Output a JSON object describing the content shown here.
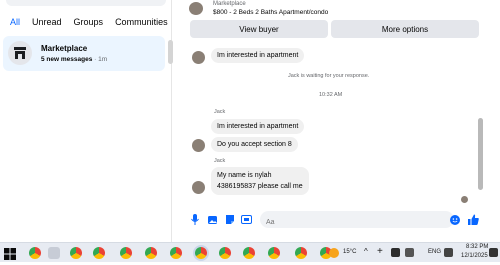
{
  "left": {
    "filters": [
      "All",
      "Unread",
      "Groups",
      "Communities"
    ],
    "conversation": {
      "title": "Marketplace",
      "new_messages": "5 new messages",
      "time": " · 1m"
    }
  },
  "header": {
    "listing_label": "Marketplace",
    "listing_title": "$800 - 2 Beds 2 Baths Apartment/condo",
    "view_buyer": "View buyer",
    "more_options": "More options"
  },
  "thread": {
    "msg1": "Im interested in apartment",
    "system_waiting": "Jack is waiting for your response.",
    "timestamp": "10:32 AM",
    "sender1": "Jack",
    "msg2": "Im interested in apartment",
    "msg3": "Do you accept section 8",
    "sender2": "Jack",
    "msg4_line1": "My name is nylah",
    "msg4_line2": "4386195837 please call me"
  },
  "composer": {
    "placeholder": "Aa"
  },
  "taskbar": {
    "weather": "15°C",
    "language": "ENG",
    "time": "8:32 PM",
    "date": "12/1/2025"
  },
  "colors": {
    "accent": "#0866ff",
    "selected_bg": "#ebf5ff",
    "bubble": "#f0f0f0",
    "button": "#e4e6eb"
  }
}
